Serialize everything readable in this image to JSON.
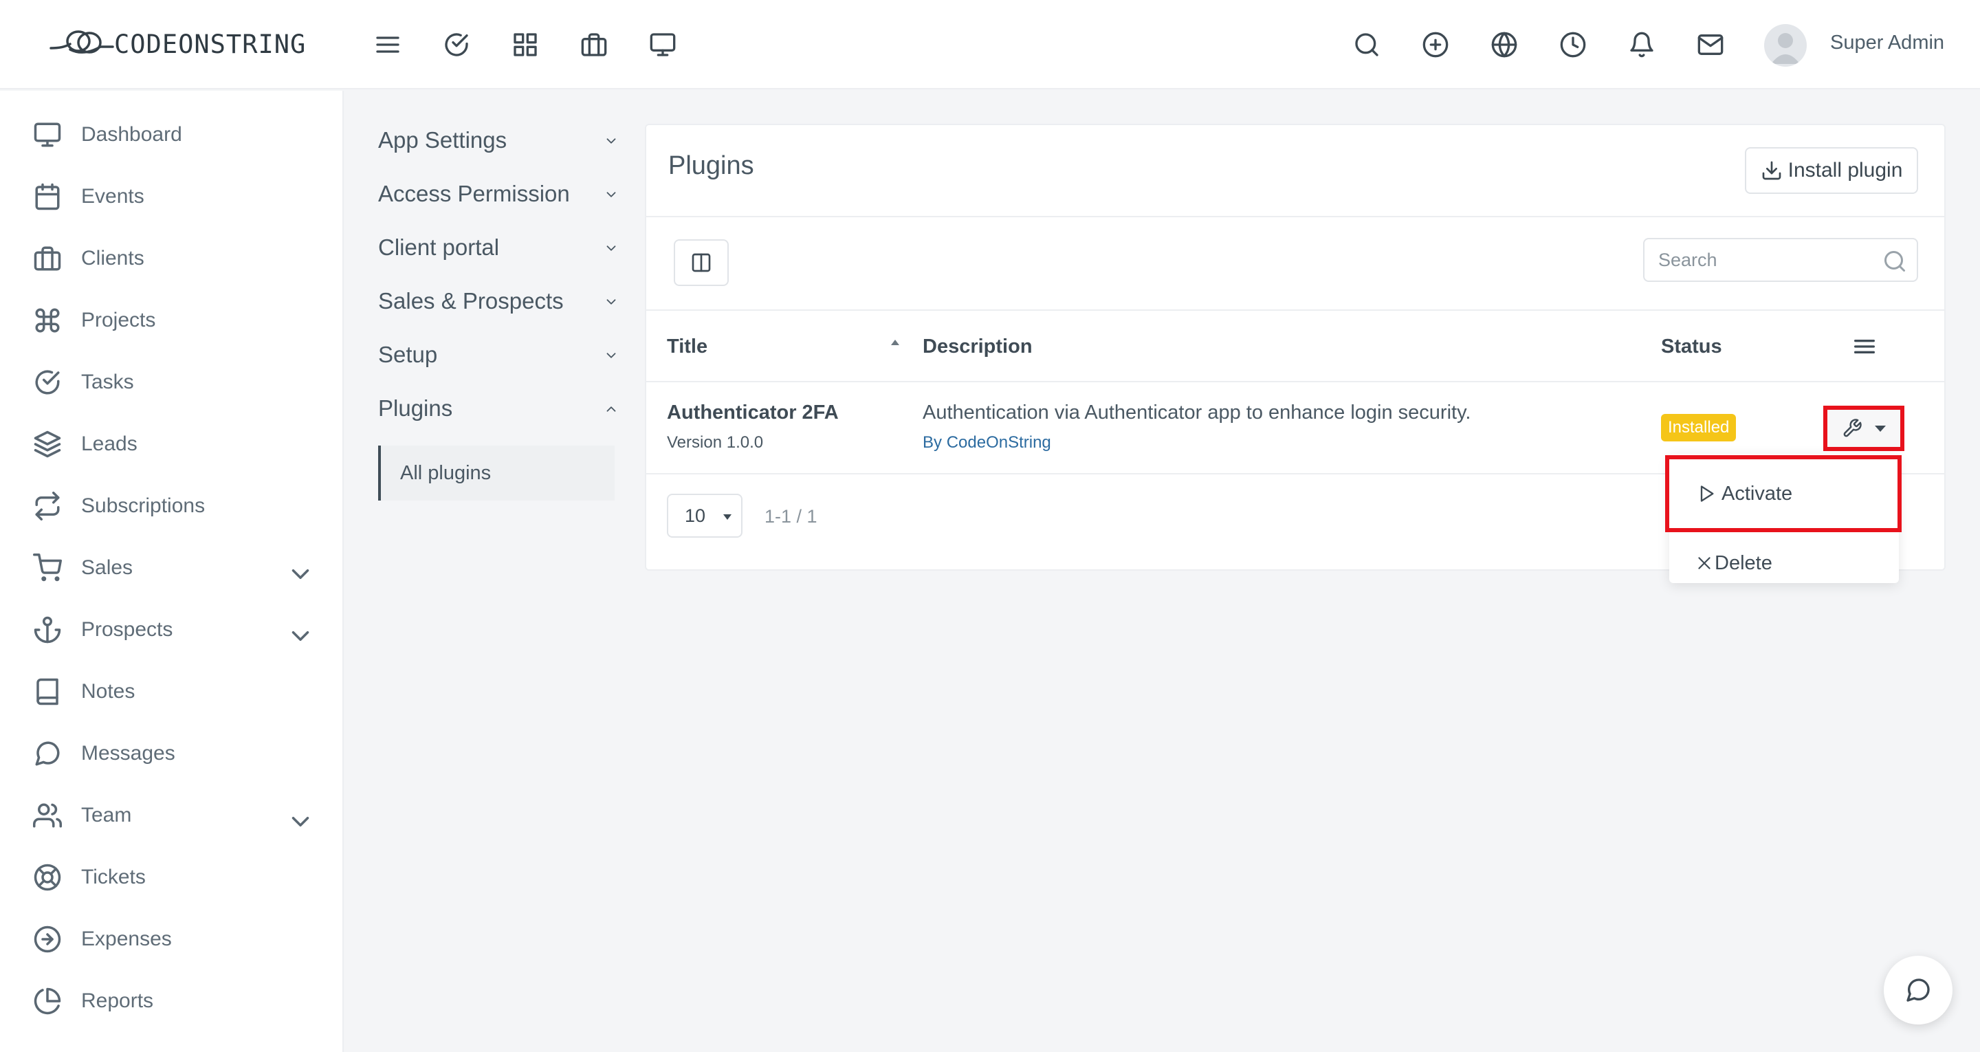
{
  "app": {
    "logo_text": "CODEONSTRING"
  },
  "topbar": {
    "icons": [
      "menu-icon",
      "check-circle-icon",
      "grid-icon",
      "briefcase-icon",
      "monitor-icon",
      "search-icon",
      "plus-circle-icon",
      "globe-icon",
      "clock-icon",
      "bell-icon",
      "mail-icon"
    ],
    "user_name": "Super Admin"
  },
  "sidebar": {
    "items": [
      {
        "label": "Dashboard",
        "icon": "monitor-icon"
      },
      {
        "label": "Events",
        "icon": "calendar-icon"
      },
      {
        "label": "Clients",
        "icon": "briefcase-icon"
      },
      {
        "label": "Projects",
        "icon": "command-icon"
      },
      {
        "label": "Tasks",
        "icon": "check-circle-icon"
      },
      {
        "label": "Leads",
        "icon": "layers-icon"
      },
      {
        "label": "Subscriptions",
        "icon": "repeat-icon"
      },
      {
        "label": "Sales",
        "icon": "cart-icon"
      },
      {
        "label": "Prospects",
        "icon": "anchor-icon"
      },
      {
        "label": "Notes",
        "icon": "book-icon"
      },
      {
        "label": "Messages",
        "icon": "message-icon"
      },
      {
        "label": "Team",
        "icon": "users-icon"
      },
      {
        "label": "Tickets",
        "icon": "life-buoy-icon"
      },
      {
        "label": "Expenses",
        "icon": "arrow-circle-icon"
      },
      {
        "label": "Reports",
        "icon": "pie-chart-icon"
      }
    ]
  },
  "settings_menu": {
    "items": [
      {
        "label": "App Settings"
      },
      {
        "label": "Access Permission"
      },
      {
        "label": "Client portal"
      },
      {
        "label": "Sales & Prospects"
      },
      {
        "label": "Setup"
      },
      {
        "label": "Plugins"
      }
    ],
    "active_sub": "All plugins"
  },
  "main": {
    "title": "Plugins",
    "install_label": "Install plugin",
    "search_placeholder": "Search",
    "columns": {
      "title": "Title",
      "description": "Description",
      "status": "Status"
    },
    "rows": [
      {
        "title": "Authenticator 2FA",
        "version": "Version 1.0.0",
        "description": "Authentication via Authenticator app to enhance login security.",
        "by_prefix": "By",
        "by": "CodeOnString",
        "status": "Installed"
      }
    ],
    "page_size": "10",
    "pager_info": "1-1 / 1"
  },
  "dropdown": {
    "activate": "Activate",
    "delete": "Delete"
  },
  "colors": {
    "badge": "#f5c518",
    "highlight": "#e8121c",
    "link": "#2c6ba0"
  }
}
